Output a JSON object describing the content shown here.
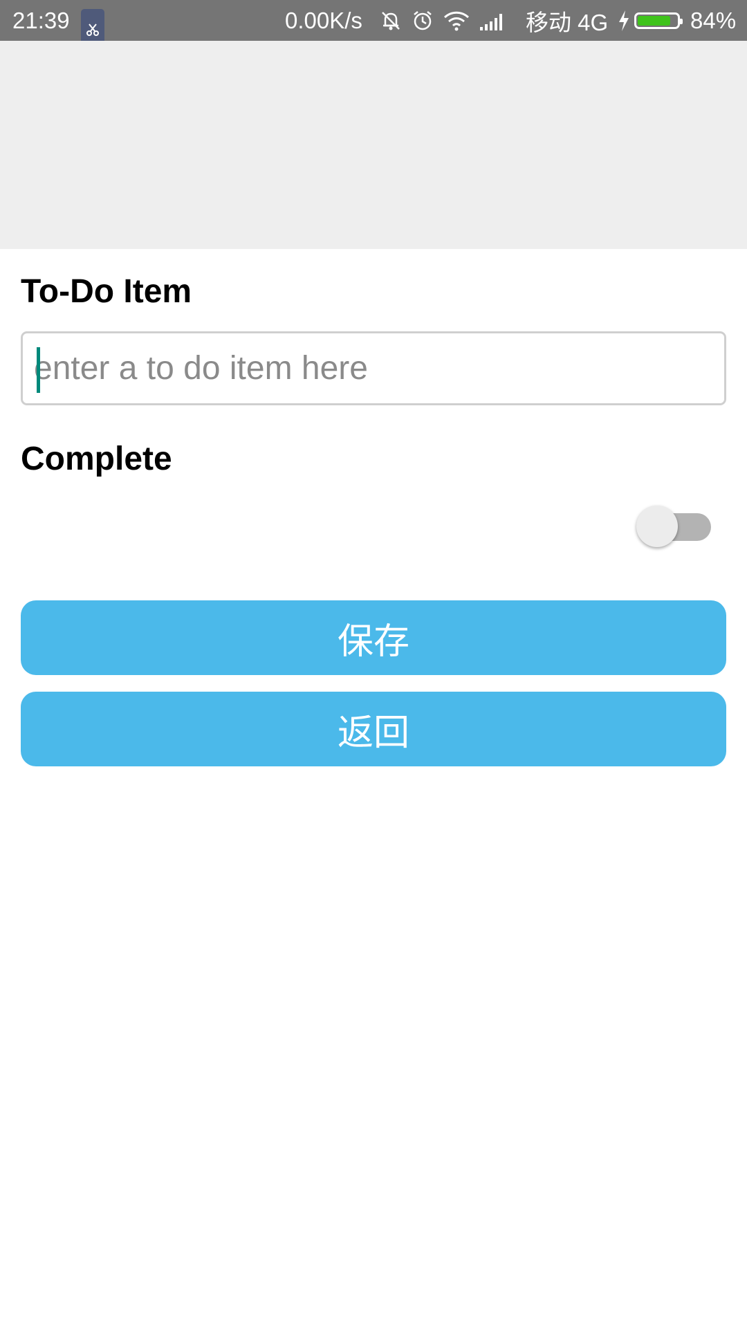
{
  "status_bar": {
    "time": "21:39",
    "app_icon": "scissors-icon",
    "network_speed": "0.00K/s",
    "carrier": "移动 4G",
    "battery_percent": "84%",
    "battery_level": 0.84,
    "icons": [
      "mute-bell-icon",
      "alarm-icon",
      "wifi-icon",
      "signal-bars-icon",
      "charging-bolt-icon",
      "battery-icon"
    ]
  },
  "form": {
    "item_label": "To-Do Item",
    "item_input": {
      "value": "",
      "placeholder": "enter a to do item here"
    },
    "complete_label": "Complete",
    "complete_toggle_on": false
  },
  "buttons": {
    "save_label": "保存",
    "back_label": "返回"
  },
  "colors": {
    "status_bar_bg": "#757575",
    "header_bg": "#eeeeee",
    "button_bg": "#4bb9ea",
    "cursor": "#00897b",
    "battery_fill": "#3fc31b"
  }
}
